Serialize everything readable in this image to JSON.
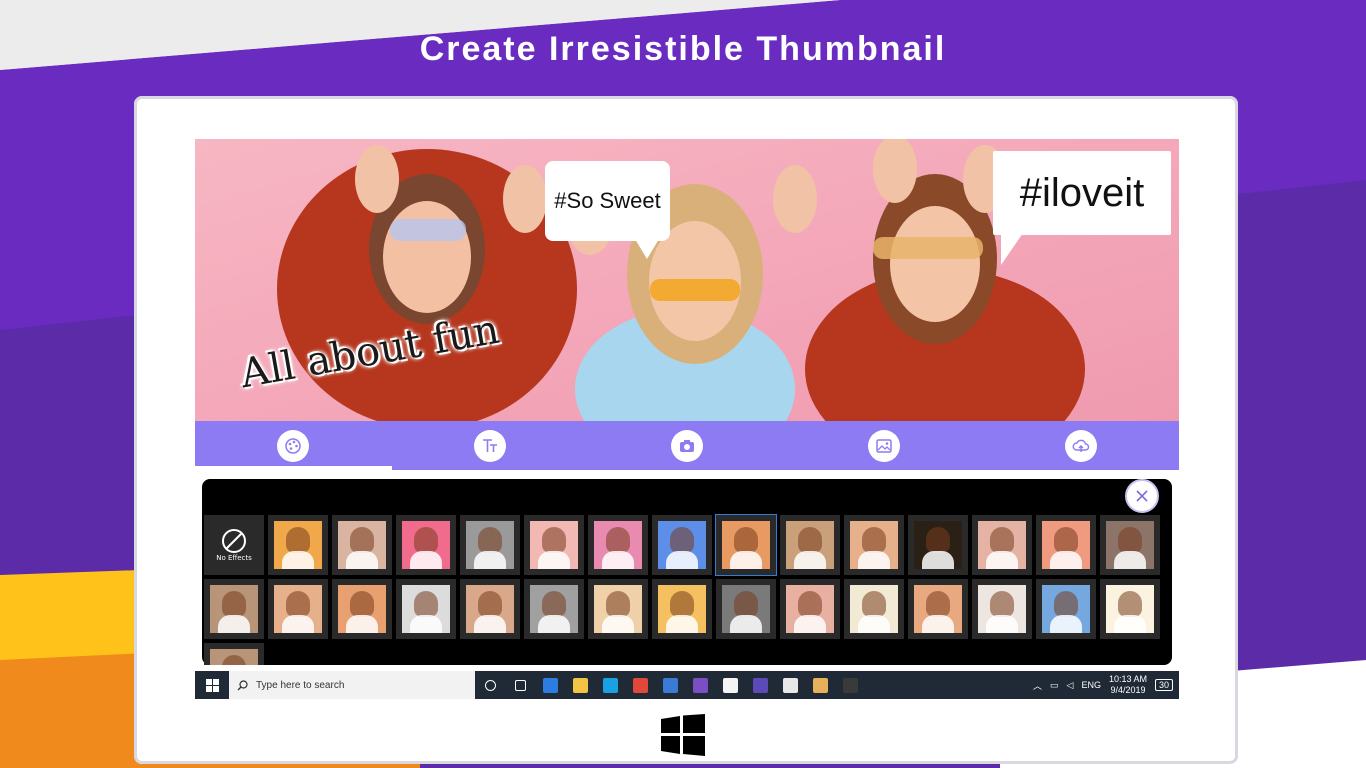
{
  "headline": "Create Irresistible Thumbnail",
  "photo": {
    "caption_fun": "All about fun",
    "bubble_sweet": "#So Sweet",
    "bubble_love": "#iloveit"
  },
  "toolbar": {
    "items": [
      {
        "name": "palette-icon",
        "glyph": "🎨"
      },
      {
        "name": "text-icon",
        "glyph": "Tт"
      },
      {
        "name": "camera-icon",
        "glyph": "📷"
      },
      {
        "name": "image-icon",
        "glyph": "🖼"
      },
      {
        "name": "cloud-upload-icon",
        "glyph": "☁"
      }
    ]
  },
  "effects": {
    "no_effects_label": "No Effects",
    "selected_index": 8,
    "row1_tints": [
      "#f1a84a",
      "#d9b4a0",
      "#f06b8c",
      "#9a9a9a",
      "#f2b8b4",
      "#e98bb0",
      "#5d8fe8",
      "#e89a63",
      "#c9a07a",
      "#e6b08a",
      "#2a2016",
      "#e5b3a4",
      "#f09a80",
      "#8c7468"
    ],
    "row2_tints": [
      "#b89478",
      "#e6b08a",
      "#e8a070",
      "#dcdcdc",
      "#d9a88a",
      "#a0a0a0",
      "#f0d0a8",
      "#f5c060",
      "#7a7a7a",
      "#e8b0a0",
      "#f3ead6",
      "#e8a880",
      "#ede6e0",
      "#76a8e0",
      "#fbf3df"
    ]
  },
  "taskbar": {
    "search_placeholder": "Type here to search",
    "apps": [
      {
        "name": "task-view-icon",
        "color": "#1f2a36"
      },
      {
        "name": "timeline-icon",
        "color": "#1f2a36"
      },
      {
        "name": "edge-icon",
        "color": "#2b7de1"
      },
      {
        "name": "file-explorer-icon",
        "color": "#f2c443"
      },
      {
        "name": "skype-icon",
        "color": "#1aa1e1"
      },
      {
        "name": "chrome-icon",
        "color": "#e0483a"
      },
      {
        "name": "store-icon",
        "color": "#3a7bd5"
      },
      {
        "name": "visual-studio-icon",
        "color": "#7b4fc4"
      },
      {
        "name": "mail-icon",
        "color": "#f4f4f4"
      },
      {
        "name": "vs-code-icon",
        "color": "#5c4ab8"
      },
      {
        "name": "photos-icon",
        "color": "#e8e8e8"
      },
      {
        "name": "paint-icon",
        "color": "#e8b05a"
      },
      {
        "name": "thumbnail-maker-icon",
        "color": "#3a3a3a"
      }
    ],
    "language": "ENG",
    "time": "10:13 AM",
    "date": "9/4/2019",
    "notification_count": "30"
  }
}
